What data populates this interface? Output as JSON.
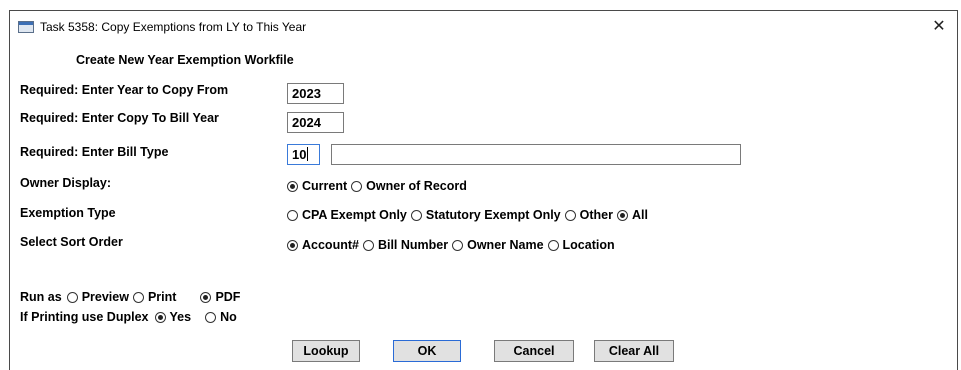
{
  "window": {
    "title": "Task 5358: Copy Exemptions from LY to This Year",
    "close_label": "✕"
  },
  "form": {
    "heading": "Create New Year Exemption Workfile",
    "year_from": {
      "label": "Required: Enter Year to Copy From",
      "value": "2023"
    },
    "year_to": {
      "label": "Required: Enter Copy To Bill Year",
      "value": "2024"
    },
    "bill_type": {
      "label": "Required: Enter Bill Type",
      "value": "10",
      "description": ""
    },
    "owner_display": {
      "label": "Owner Display:",
      "options": [
        "Current",
        "Owner of Record"
      ],
      "selected": "Current"
    },
    "exemption_type": {
      "label": "Exemption Type",
      "options": [
        "CPA Exempt Only",
        "Statutory Exempt Only",
        "Other",
        "All"
      ],
      "selected": "All"
    },
    "sort_order": {
      "label": "Select Sort Order",
      "options": [
        "Account#",
        "Bill Number",
        "Owner Name",
        "Location"
      ],
      "selected": "Account#"
    },
    "run_as": {
      "label": "Run as",
      "options": [
        "Preview",
        "Print",
        "PDF"
      ],
      "selected": "PDF"
    },
    "duplex": {
      "label": "If Printing use Duplex",
      "options": [
        "Yes",
        "No"
      ],
      "selected": "Yes"
    }
  },
  "buttons": {
    "lookup": "Lookup",
    "ok": "OK",
    "cancel": "Cancel",
    "clear_all": "Clear All"
  }
}
